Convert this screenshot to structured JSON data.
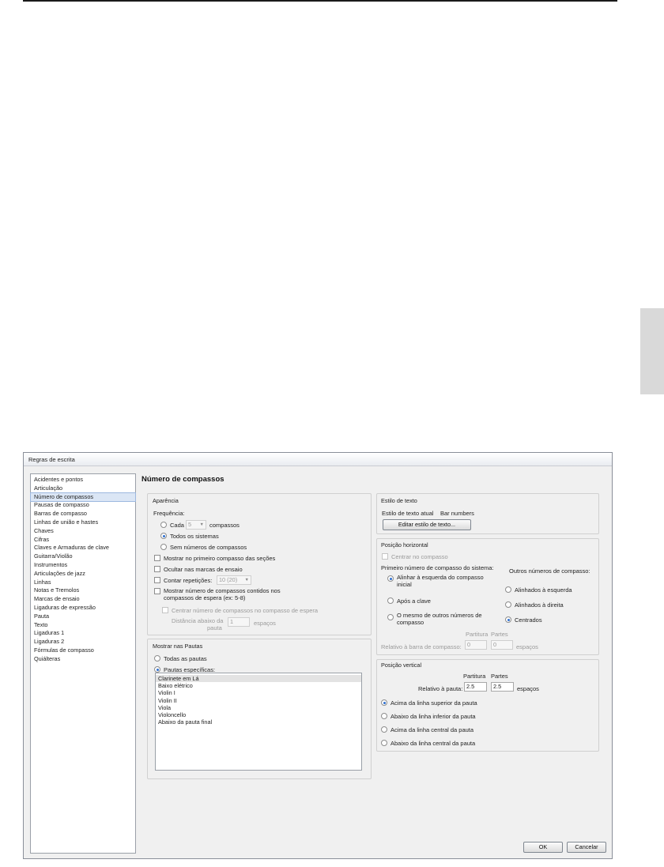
{
  "window_title": "Regras de escrita",
  "categories": [
    "Acidentes e pontos",
    "Articulação",
    "Número de compassos",
    "Pausas de compasso",
    "Barras de compasso",
    "Linhas de união e hastes",
    "Chaves",
    "Cifras",
    "Claves e Armaduras de clave",
    "Guitarra/Violão",
    "Instrumentos",
    "Articulações de jazz",
    "Linhas",
    "Notas e Tremolos",
    "Marcas de ensaio",
    "Ligaduras de expressão",
    "Pauta",
    "Texto",
    "Ligaduras 1",
    "Ligaduras 2",
    "Fórmulas de compasso",
    "Quiálteras"
  ],
  "selected_category": "Número de compassos",
  "page_title": "Número de compassos",
  "appearance": {
    "title": "Aparência",
    "frequency_label": "Frequência:",
    "every_label": "Cada",
    "every_value": "5",
    "measures_label": "compassos",
    "every_system_label": "Todos os sistemas",
    "no_numbers_label": "Sem números de compassos",
    "frequency_selected": "Todos os sistemas",
    "show_first_label": "Mostrar no primeiro compasso das seções",
    "hide_rehearsal_label": "Ocultar nas marcas de ensaio",
    "count_repeats_label": "Contar repetições:",
    "count_repeats_value": "10 (20)",
    "multirest_label_1": "Mostrar número de compassos contidos nos",
    "multirest_label_2": "compassos de espera (ex: 5-8)",
    "center_multirest_label": "Centrar número de compassos no compasso de espera",
    "distance_label_1": "Distância abaixo da",
    "distance_label_2": "pauta",
    "distance_value": "1",
    "spaces_label": "espaços"
  },
  "show_on_staves": {
    "title": "Mostrar nas Pautas",
    "all_staves_label": "Todas as pautas",
    "specific_staves_label": "Pautas específicas:",
    "selected_option": "Pautas específicas:",
    "staves": [
      "Clarinete em Lá",
      "Baixo elétrico",
      "Violin I",
      "Violin II",
      "Viola",
      "Violoncello",
      "Abaixo da pauta final"
    ],
    "selected_staff": "Clarinete em Lá"
  },
  "text_style": {
    "title": "Estilo de texto",
    "current_label": "Estilo de texto atual",
    "current_value": "Bar numbers",
    "edit_button": "Editar estilo de texto..."
  },
  "horizontal_position": {
    "title": "Posição horizontal",
    "center_label": "Centrar no compasso",
    "first_number_label": "Primeiro número de compasso do sistema:",
    "align_left_label_1": "Alinhar à esquerda do compasso",
    "align_left_label_2": "inicial",
    "after_clef_label": "Após a clave",
    "same_as_others_label_1": "O mesmo de outros números de",
    "same_as_others_label_2": "compasso",
    "first_selected": "Alinhar à esquerda do compasso inicial",
    "other_numbers_label": "Outros números de compasso:",
    "left_aligned_label": "Alinhados à esquerda",
    "right_aligned_label": "Alinhados à direita",
    "centered_label": "Centrados",
    "other_selected": "Centrados",
    "score_label": "Partitura",
    "parts_label": "Partes",
    "relative_label": "Relativo à barra de compasso:",
    "score_value": "0",
    "parts_value": "0",
    "spaces_label": "espaços"
  },
  "vertical_position": {
    "title": "Posição vertical",
    "score_label": "Partitura",
    "parts_label": "Partes",
    "relative_label": "Relativo à pauta:",
    "score_value": "2.5",
    "parts_value": "2.5",
    "spaces_label": "espaços",
    "options": [
      "Acima da linha superior da pauta",
      "Abaixo da linha inferior da pauta",
      "Acima da linha central da pauta",
      "Abaixo da linha central da pauta"
    ],
    "selected": "Acima da linha superior da pauta"
  },
  "buttons": {
    "ok": "OK",
    "cancel": "Cancelar"
  }
}
